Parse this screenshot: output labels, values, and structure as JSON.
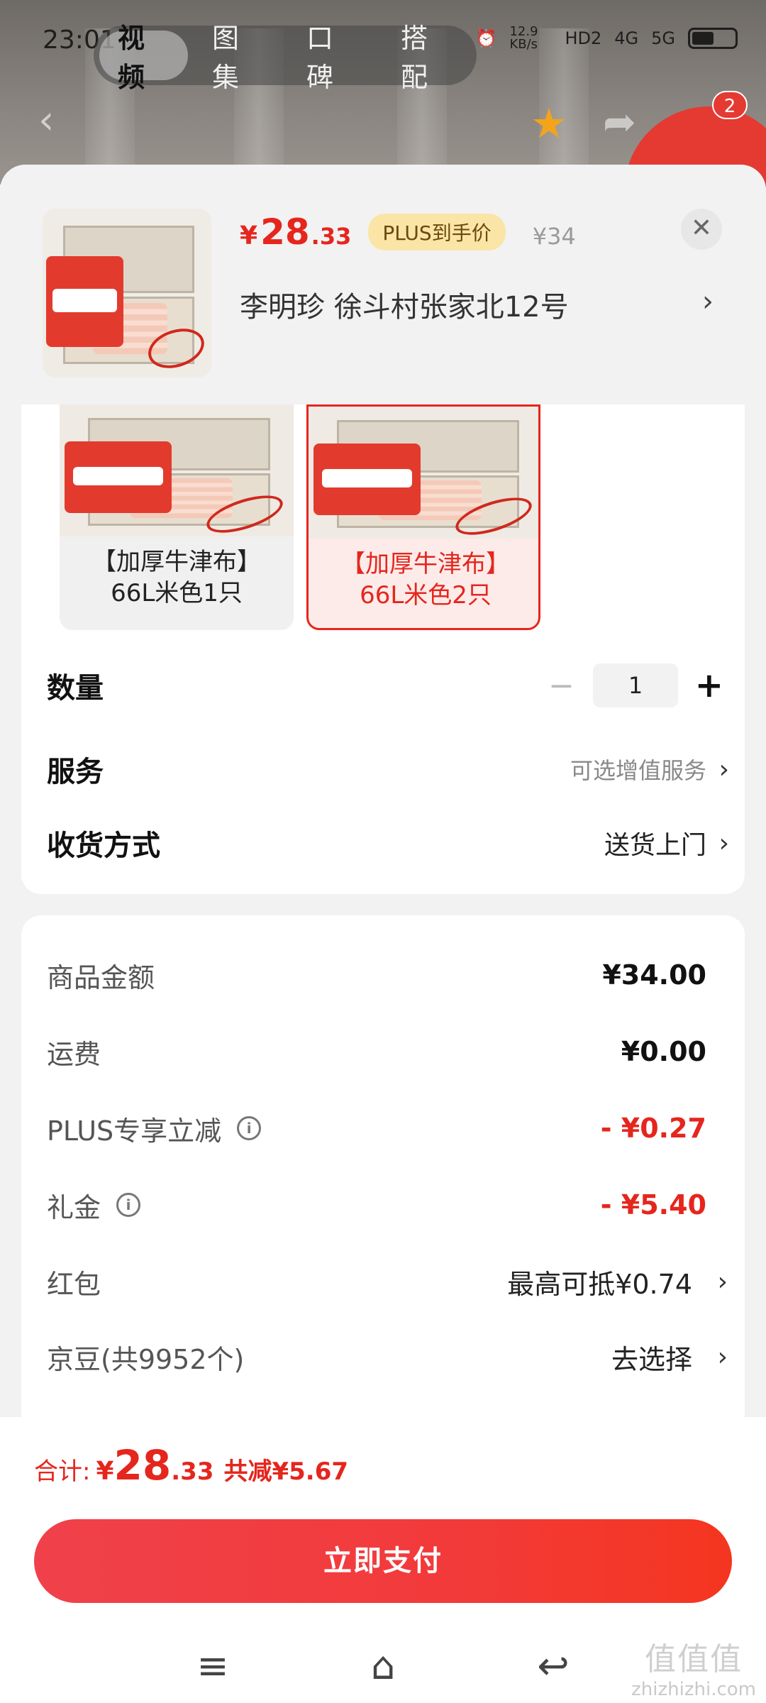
{
  "status_bar": {
    "time": "23:01",
    "net_speed": "12.9 KB/s",
    "hd": "HD2",
    "signal_1": "4G",
    "signal_2": "5G"
  },
  "top_tabs": [
    "视频",
    "图集",
    "口碑",
    "搭配"
  ],
  "cart_badge_count": "2",
  "product": {
    "price_symbol": "¥",
    "price_int": "28",
    "price_dec": ".33",
    "plus_tag": "PLUS到手价",
    "orig_price": "¥34",
    "address": "李明珍  徐斗村张家北12号"
  },
  "sku_options": [
    {
      "label_line1": "【加厚牛津布】",
      "label_line2": "66L米色1只",
      "selected": false
    },
    {
      "label_line1": "【加厚牛津布】",
      "label_line2": "66L米色2只",
      "selected": true
    }
  ],
  "quantity": {
    "label": "数量",
    "value": "1",
    "minus": "−",
    "plus": "+"
  },
  "service": {
    "label": "服务",
    "value": "可选增值服务"
  },
  "delivery": {
    "label": "收货方式",
    "value": "送货上门"
  },
  "fees": {
    "goods": {
      "label": "商品金额",
      "value": "¥34.00"
    },
    "shipping": {
      "label": "运费",
      "value": "¥0.00"
    },
    "plus_discount": {
      "label": "PLUS专享立减",
      "value": "- ¥0.27"
    },
    "gift": {
      "label": "礼金",
      "value": "- ¥5.40"
    },
    "red_packet": {
      "label": "红包",
      "value": "最高可抵¥0.74"
    },
    "jingdou": {
      "label": "京豆(共9952个)",
      "value": "去选择"
    }
  },
  "total": {
    "label": "合计:",
    "symbol": "¥",
    "int": "28",
    "dec": ".33",
    "saved": "共减¥5.67"
  },
  "pay_button": "立即支付",
  "watermark": {
    "top": "值值值",
    "bottom": "zhizhizhi.com"
  },
  "colors": {
    "accent_red": "#e5261d",
    "plus_gold": "#fbe5a6",
    "star": "#f3a41a"
  }
}
